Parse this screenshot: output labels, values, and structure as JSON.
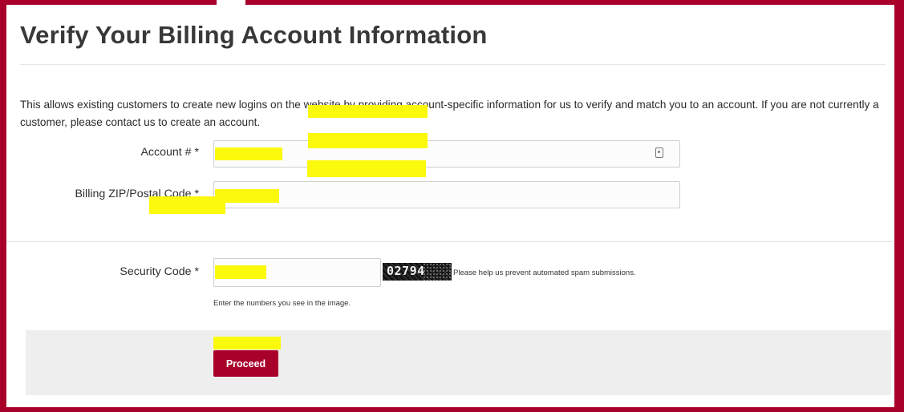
{
  "page": {
    "title": "Verify Your Billing Account Information",
    "intro": "This allows existing customers to create new logins on the website by providing account-specific information for us to verify and match you to an account. If you are not currently a customer, please contact us to create an account."
  },
  "form": {
    "account": {
      "label": "Account # *",
      "value": "",
      "icon": "contact-card-icon"
    },
    "zip": {
      "label": "Billing ZIP/Postal Code *",
      "value": ""
    },
    "security": {
      "label": "Security Code *",
      "value": "",
      "captcha_text": "02794",
      "captcha_note": "Please help us prevent automated spam submissions.",
      "hint": "Enter the numbers you see in the image."
    },
    "proceed_label": "Proceed"
  },
  "colors": {
    "brand": "#a8002b",
    "highlight": "#fbf90c",
    "footer_bg": "#eeeeef"
  }
}
